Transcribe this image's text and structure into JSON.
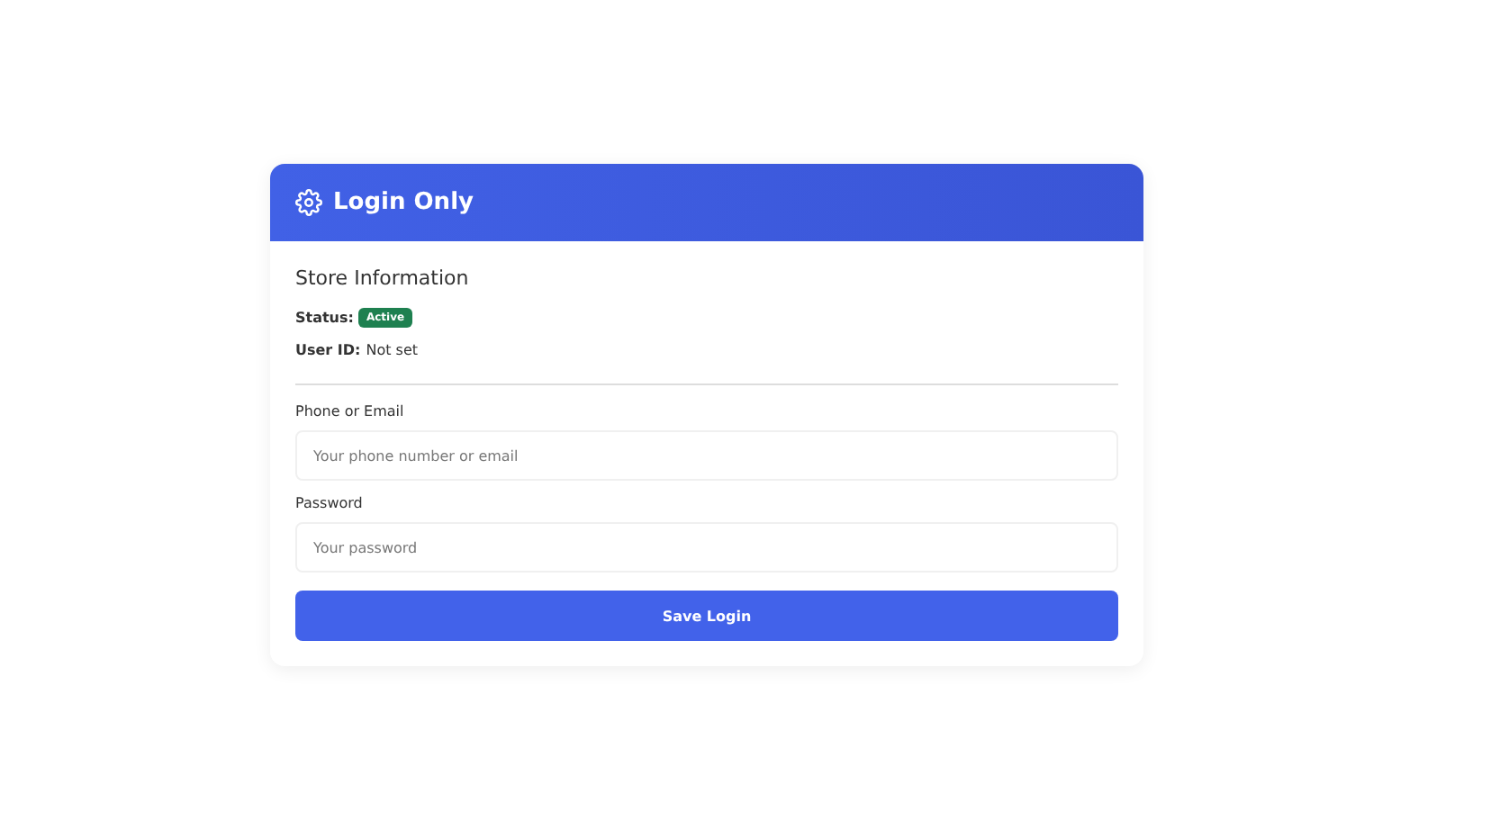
{
  "card": {
    "title": "Login Only"
  },
  "store_info": {
    "heading": "Store Information",
    "rows": [
      {
        "kind": "badge",
        "label": "Status:",
        "value": "Active"
      },
      {
        "kind": "text",
        "label": "User ID:",
        "value": "Not set"
      }
    ]
  },
  "fields": [
    {
      "label": "Phone or Email",
      "placeholder": "Your phone number or email"
    },
    {
      "label": "Password",
      "placeholder": "Your password"
    }
  ],
  "submit_button": "Save Login"
}
